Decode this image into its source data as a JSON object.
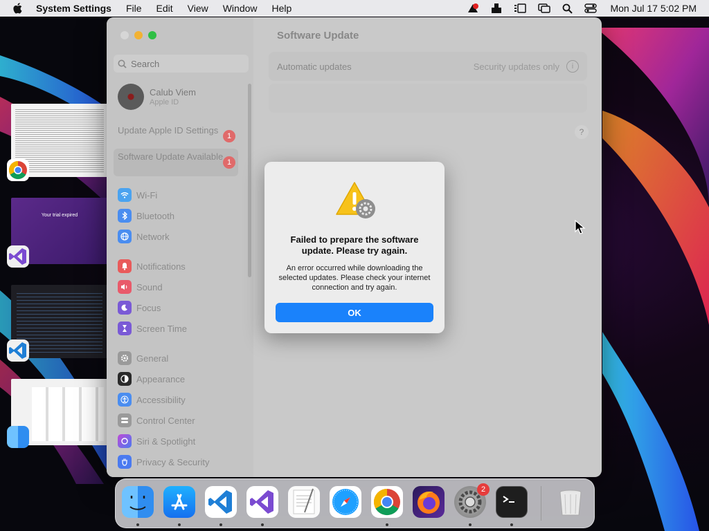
{
  "menubar": {
    "app_name": "System Settings",
    "menus": [
      "File",
      "Edit",
      "View",
      "Window",
      "Help"
    ],
    "clock": "Mon Jul 17  5:02 PM"
  },
  "window": {
    "title": "Software Update",
    "search_placeholder": "Search",
    "profile": {
      "name": "Calub Viem",
      "subtitle": "Apple ID"
    },
    "notices": [
      {
        "label": "Update Apple ID Settings",
        "badge": "1"
      },
      {
        "label": "Software Update Available",
        "badge": "1"
      }
    ],
    "sidebar_items": [
      {
        "label": "Wi-Fi",
        "icon": "wifi-icon",
        "color": "#4aa3f0"
      },
      {
        "label": "Bluetooth",
        "icon": "bluetooth-icon",
        "color": "#4a8df0"
      },
      {
        "label": "Network",
        "icon": "globe-icon",
        "color": "#4a8df0"
      },
      {
        "label": "Notifications",
        "icon": "bell-icon",
        "color": "#e95a5a"
      },
      {
        "label": "Sound",
        "icon": "speaker-icon",
        "color": "#e95a6a"
      },
      {
        "label": "Focus",
        "icon": "moon-icon",
        "color": "#7a5ad6"
      },
      {
        "label": "Screen Time",
        "icon": "hourglass-icon",
        "color": "#7a5ad6"
      },
      {
        "label": "General",
        "icon": "gear-icon",
        "color": "#9a9a9a"
      },
      {
        "label": "Appearance",
        "icon": "appearance-icon",
        "color": "#2a2a2a"
      },
      {
        "label": "Accessibility",
        "icon": "accessibility-icon",
        "color": "#4a8df0"
      },
      {
        "label": "Control Center",
        "icon": "control-center-icon",
        "color": "#9a9a9a"
      },
      {
        "label": "Siri & Spotlight",
        "icon": "siri-icon",
        "color": "#c04ad6"
      },
      {
        "label": "Privacy & Security",
        "icon": "hand-icon",
        "color": "#4a7af0"
      }
    ],
    "automatic_updates": {
      "label": "Automatic updates",
      "value": "Security updates only"
    },
    "help": "?"
  },
  "alert": {
    "title": "Failed to prepare the software update. Please try again.",
    "body": "An error occurred while downloading the selected updates. Please check your internet connection and try again.",
    "ok": "OK"
  },
  "thumbnails": {
    "trial_text": "Your trial expired"
  },
  "dock": {
    "apps": [
      "finder",
      "app-store",
      "vscode",
      "visual-studio",
      "textedit",
      "safari",
      "chrome",
      "firefox",
      "system-settings",
      "terminal"
    ],
    "settings_badge": "2"
  }
}
